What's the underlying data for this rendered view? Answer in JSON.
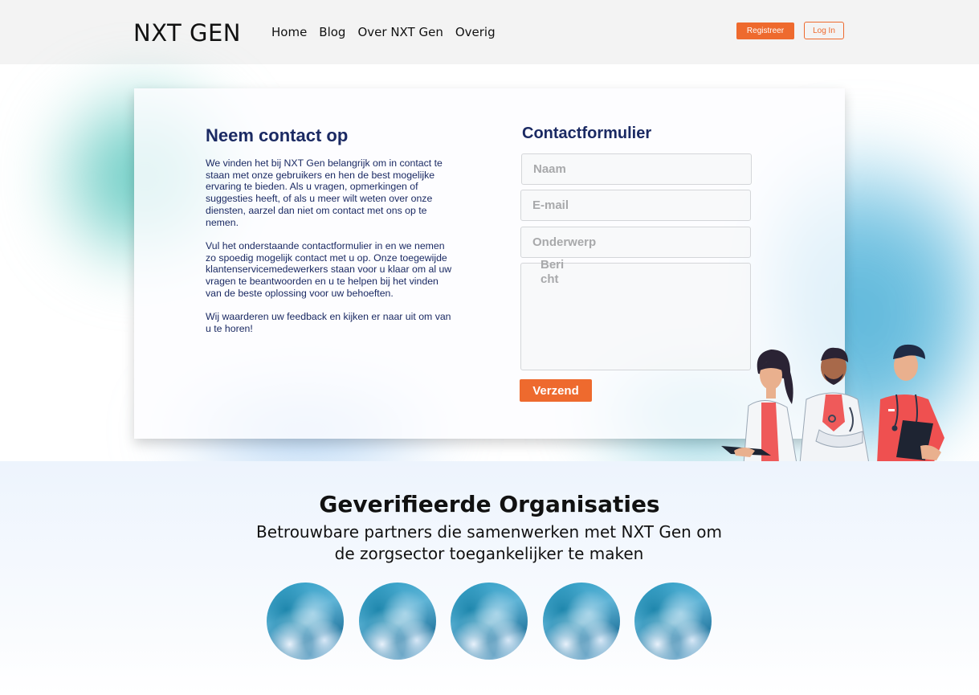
{
  "header": {
    "logo": "NXT GEN",
    "nav": [
      "Home",
      "Blog",
      "Over NXT Gen",
      "Overig"
    ],
    "register_label": "Registreer",
    "login_label": "Log In"
  },
  "contact": {
    "title": "Neem contact op",
    "paragraphs": [
      "We vinden het bij NXT Gen belangrijk om in contact te staan met onze gebruikers en hen de best mogelijke ervaring te bieden. Als u vragen, opmerkingen of suggesties heeft, of als u meer wilt weten over onze diensten, aarzel dan niet om contact met ons op te nemen.",
      "Vul het onderstaande contactformulier in en we nemen zo spoedig mogelijk contact met u op. Onze toegewijde klantenservicemedewerkers staan voor u klaar om al uw vragen te beantwoorden en u te helpen bij het vinden van de beste oplossing voor uw behoeften.",
      "Wij waarderen uw feedback en kijken er naar uit om van u te horen!"
    ]
  },
  "form": {
    "title": "Contactformulier",
    "name_placeholder": "Naam",
    "email_placeholder": "E-mail",
    "subject_placeholder": "Onderwerp",
    "message_placeholder": "Bericht",
    "submit_label": "Verzend"
  },
  "orgs": {
    "title": "Geverifieerde Organisaties",
    "subtitle_line1": "Betrouwbare partners die samenwerken met NXT Gen om",
    "subtitle_line2": "de zorgsector toegankelijker te maken",
    "logo_count": 5
  },
  "colors": {
    "accent": "#ee6a2e",
    "heading": "#1b2a63",
    "header_bg": "#f3f3f3"
  }
}
